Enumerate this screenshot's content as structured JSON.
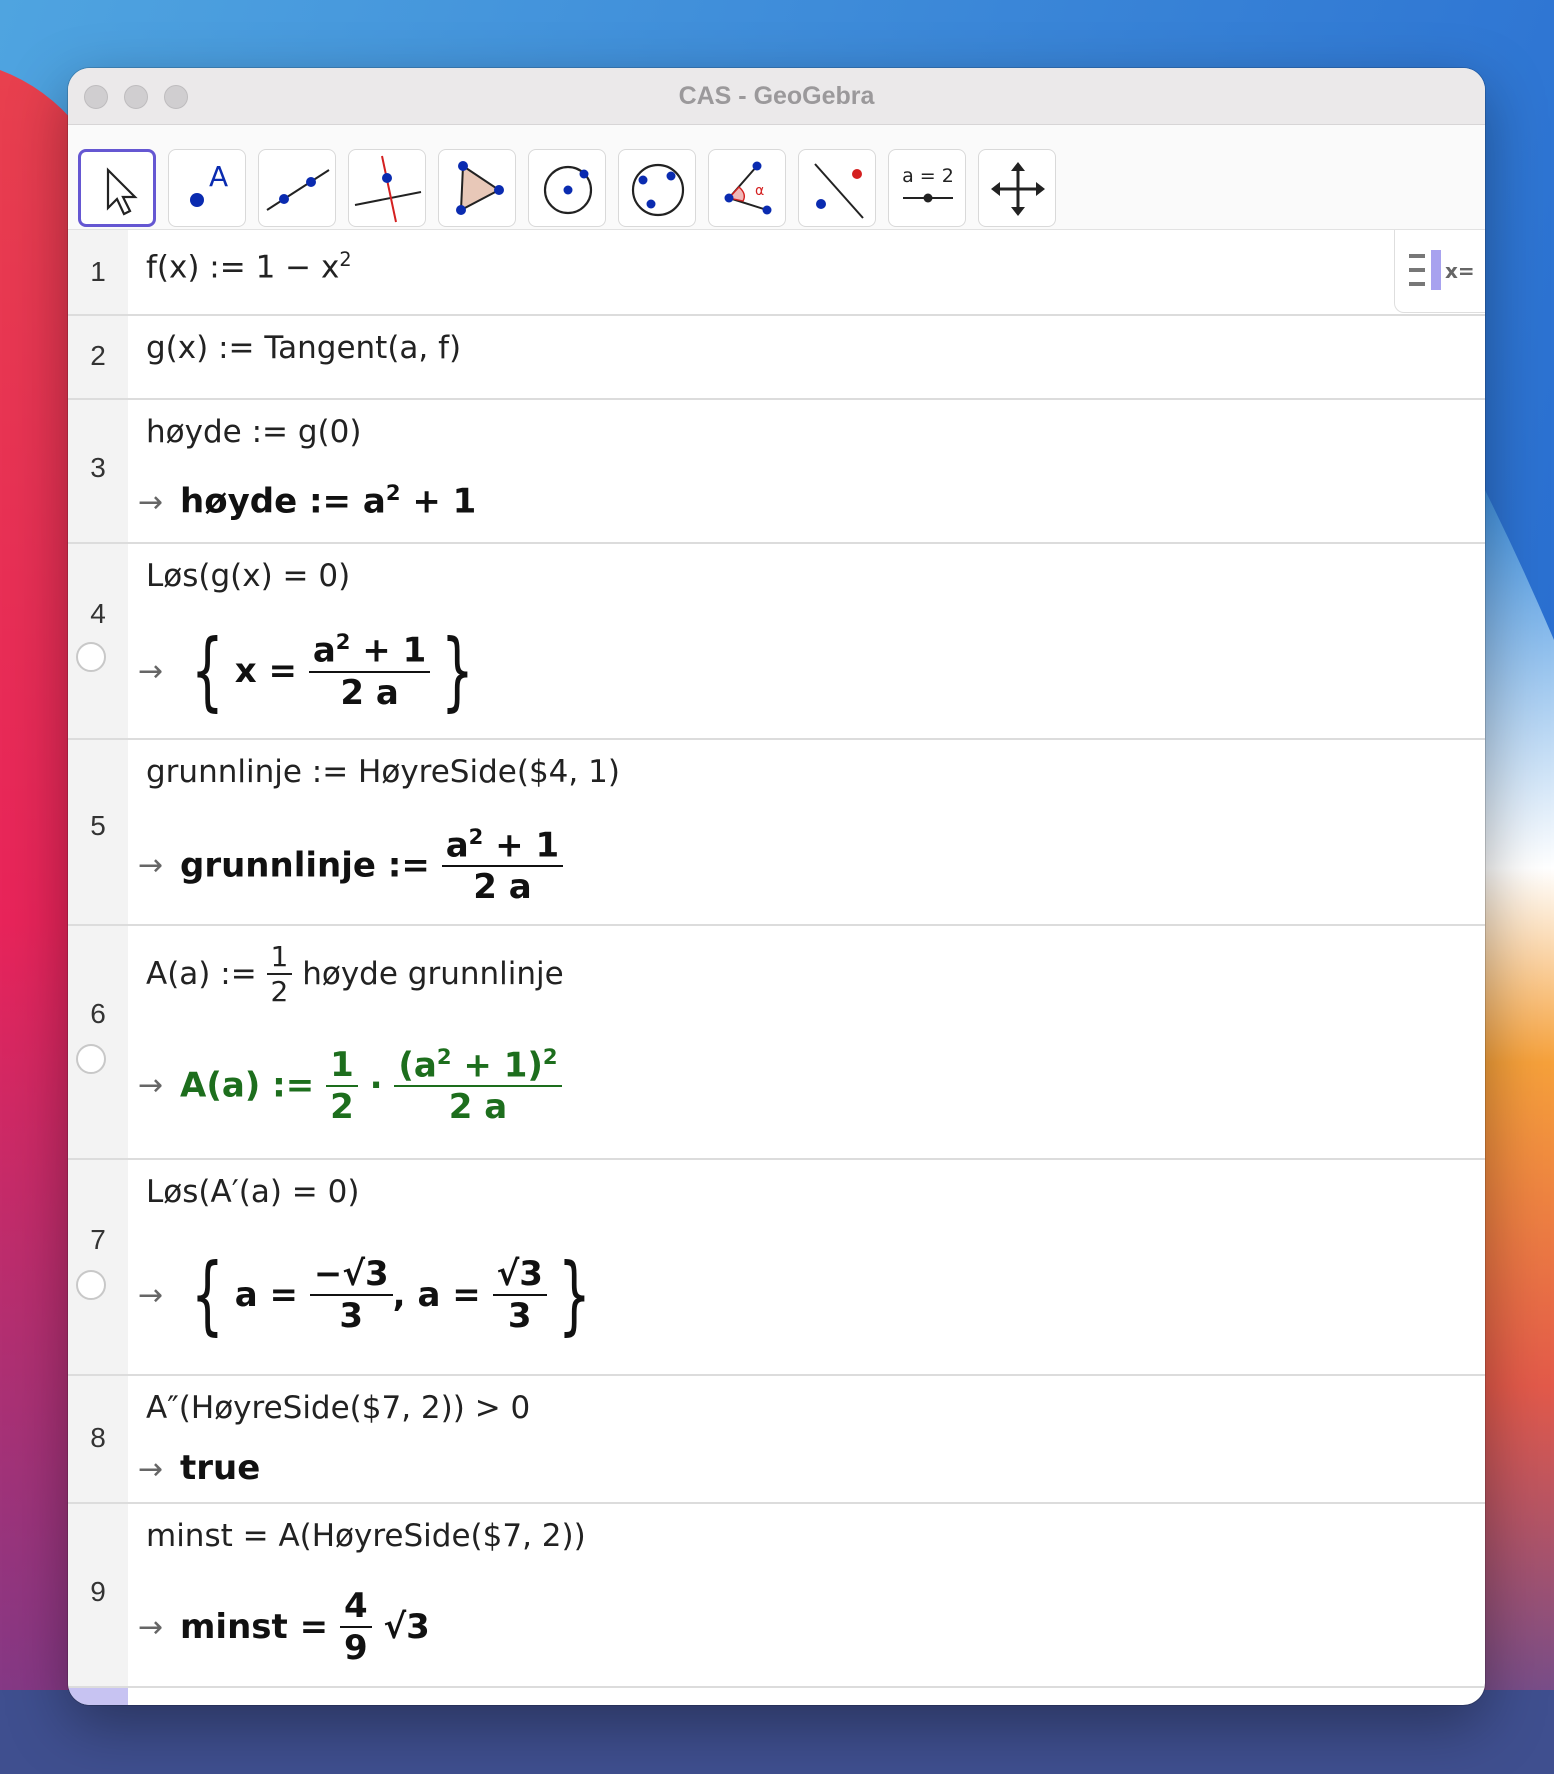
{
  "window": {
    "title": "CAS - GeoGebra"
  },
  "toolbar": {
    "tools": [
      {
        "name": "move-tool-icon"
      },
      {
        "name": "point-tool-icon",
        "label": "A"
      },
      {
        "name": "line-tool-icon"
      },
      {
        "name": "perpendicular-line-tool-icon"
      },
      {
        "name": "polygon-tool-icon"
      },
      {
        "name": "circle-center-point-tool-icon"
      },
      {
        "name": "circle-three-points-tool-icon"
      },
      {
        "name": "angle-tool-icon",
        "label": "α"
      },
      {
        "name": "reflect-tool-icon"
      },
      {
        "name": "slider-tool-icon",
        "label": "a = 2"
      },
      {
        "name": "move-graphics-view-tool-icon"
      }
    ],
    "undo": "undo-icon",
    "redo": "redo-icon",
    "search": "search-icon",
    "menu": "menu-icon",
    "side_toggle_label": "x="
  },
  "rows": [
    {
      "n": "1",
      "input": "f(x) := 1 − x",
      "input_sup": "2"
    },
    {
      "n": "2",
      "input": "g(x) := Tangent(a, f)"
    },
    {
      "n": "3",
      "input": "høyde := g(0)",
      "output_lhs": "høyde  :=  a",
      "output_sup": "2",
      "output_rhs": " + 1"
    },
    {
      "n": "4",
      "input": "Løs(g(x)  =  0)",
      "out_x": "x =",
      "num_a": "a",
      "num_sup": "2",
      "num_rest": " + 1",
      "den": "2 a"
    },
    {
      "n": "5",
      "input": "grunnlinje := HøyreSide($4, 1)",
      "output_lhs": "grunnlinje  :=",
      "num_a": "a",
      "num_sup": "2",
      "num_rest": " + 1",
      "den": "2 a"
    },
    {
      "n": "6",
      "input_lhs": "A(a) :=",
      "in_num": "1",
      "in_den": "2",
      "input_rhs": "høyde grunnlinje",
      "output_lhs": "A(a)  :=",
      "o_num": "1",
      "o_den": "2",
      "dot": "·",
      "o2_num_a": "(a",
      "o2_num_sup": "2",
      "o2_num_rest": " + 1)",
      "o2_num_sup2": "2",
      "o2_den": "2 a",
      "color": "#1d6e1d"
    },
    {
      "n": "7",
      "input": "Løs(A′(a)  =  0)",
      "a1": "a =",
      "n1": "−√3",
      "d1": "3",
      "sep": ",",
      "a2": "a =",
      "n2": "√3",
      "d2": "3"
    },
    {
      "n": "8",
      "input": "A″(HøyreSide($7, 2)) > 0",
      "output": "true"
    },
    {
      "n": "9",
      "input": "minst  =  A(HøyreSide($7, 2))",
      "output_lhs": "minst =",
      "num": "4",
      "den": "9",
      "rest": "√3"
    }
  ]
}
